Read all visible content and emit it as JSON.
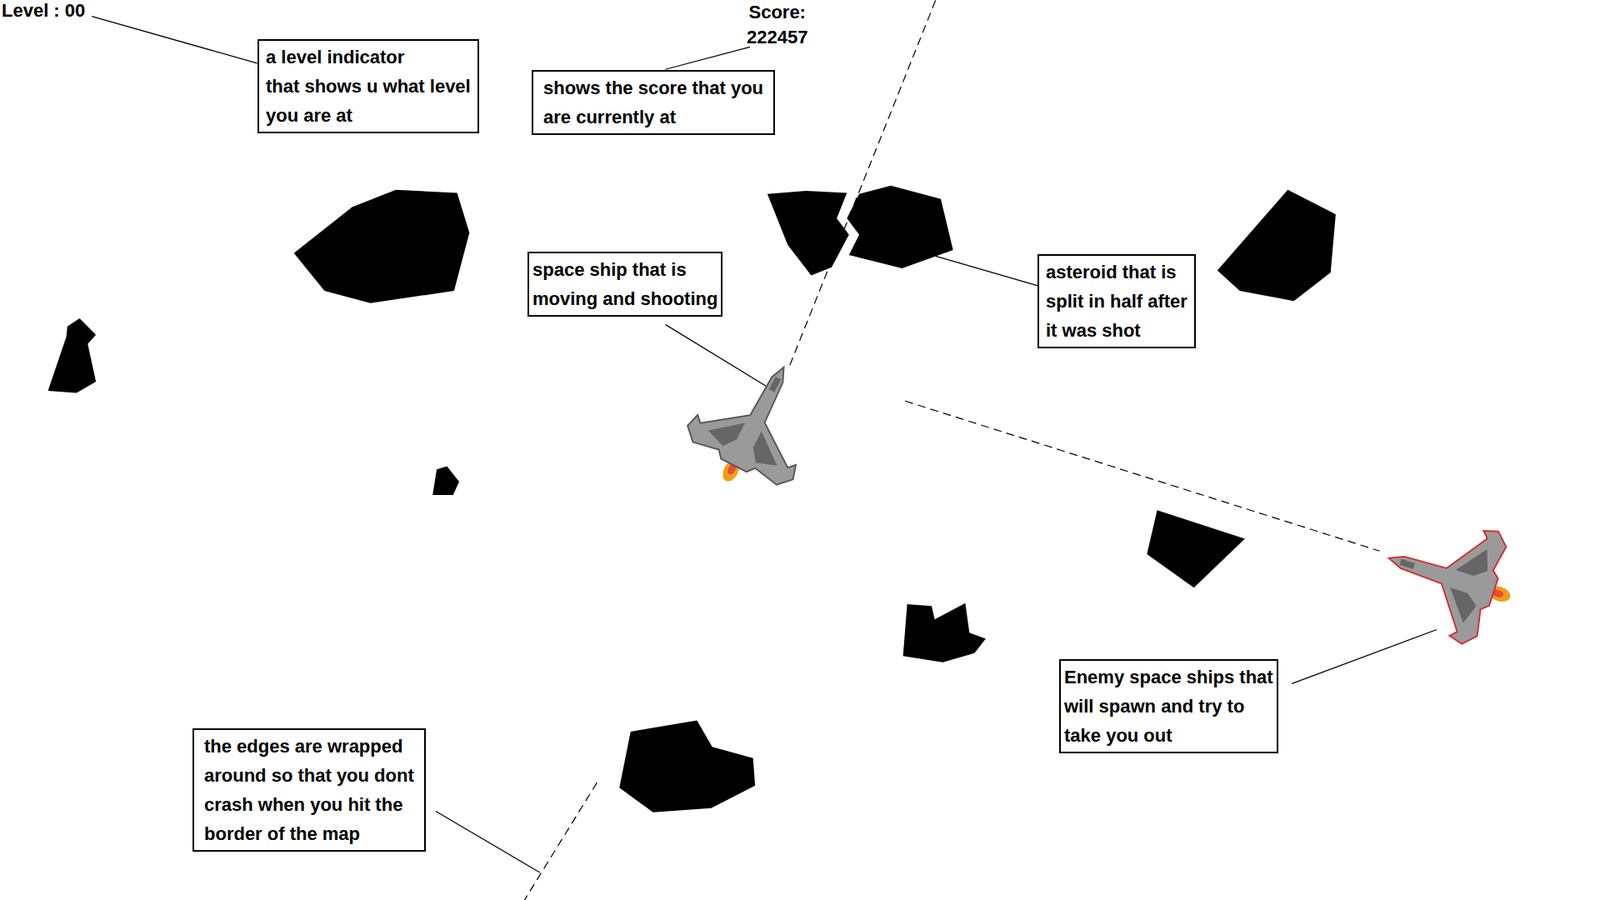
{
  "hud": {
    "level": "Level : 00",
    "score_label": "Score:",
    "score": "222457"
  },
  "ships": [
    {
      "kind": "player"
    },
    {
      "kind": "enemy"
    }
  ],
  "annotations": [
    {
      "lines": [
        "a level indicator",
        "that shows u what level",
        "you are at"
      ]
    },
    {
      "lines": [
        "shows the score that you",
        "are currently at"
      ]
    },
    {
      "lines": [
        "space ship that is",
        "moving and shooting"
      ]
    },
    {
      "lines": [
        "asteroid that is",
        "split in half after",
        "it was shot"
      ]
    },
    {
      "lines": [
        "Enemy space ships that",
        "will spawn and try to",
        "take you out"
      ]
    },
    {
      "lines": [
        "the edges are wrapped",
        "around so that you dont",
        "crash when you hit the",
        "border of the map"
      ]
    }
  ]
}
